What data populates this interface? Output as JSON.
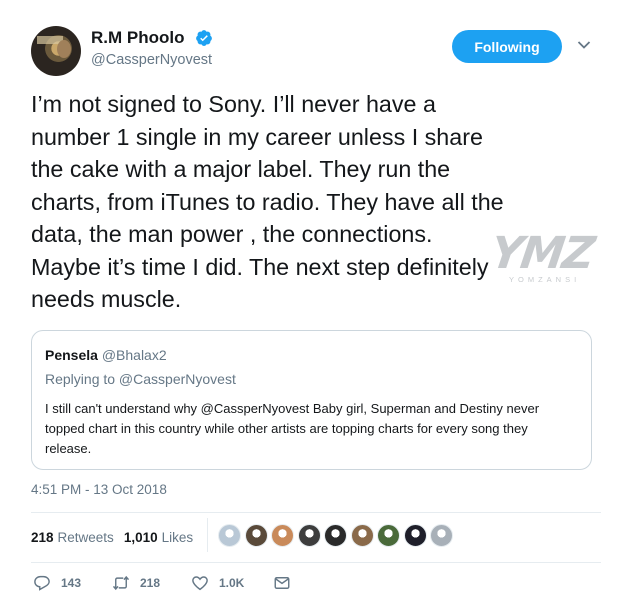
{
  "author": {
    "display_name": "R.M Phoolo",
    "handle": "@CassperNyovest",
    "verified": true,
    "follow_button_label": "Following"
  },
  "tweet": {
    "lines": [
      "I’m not signed to Sony. I’ll never have a",
      "number 1 single in my career unless I share",
      "the cake with a major label. They run the",
      "charts, from iTunes to radio. They have all the",
      "data, the man power , the connections.",
      "Maybe it’s time I did. The next step definitely",
      "needs muscle."
    ]
  },
  "watermark": {
    "logo_text": "YMZ",
    "sub_text": "YOMZANSI"
  },
  "quoted_tweet": {
    "name": "Pensela",
    "handle": "@Bhalax2",
    "replying_to": "Replying to @CassperNyovest",
    "lines": [
      "I still can't understand why @CassperNyovest Baby girl, Superman and Destiny never",
      "topped chart in this country while other artists are topping charts for every song they",
      "release."
    ]
  },
  "timestamp": "4:51 PM - 13 Oct 2018",
  "stats": {
    "retweets_count": "218",
    "retweets_label": "Retweets",
    "likes_count": "1,010",
    "likes_label": "Likes"
  },
  "liker_avatars": [
    {
      "icon": "liker-avatar",
      "color": "#b9c8d6"
    },
    {
      "icon": "liker-avatar",
      "color": "#5a4a3a"
    },
    {
      "icon": "liker-avatar",
      "color": "#c98a5a"
    },
    {
      "icon": "liker-avatar",
      "color": "#3d3d3d"
    },
    {
      "icon": "liker-avatar",
      "color": "#2a2a2a"
    },
    {
      "icon": "liker-avatar",
      "color": "#8a6a4a"
    },
    {
      "icon": "liker-avatar",
      "color": "#4a6a3a"
    },
    {
      "icon": "liker-avatar",
      "color": "#1f1f2a"
    },
    {
      "icon": "liker-avatar",
      "color": "#a8b0b8"
    }
  ],
  "actions": {
    "reply_count": "143",
    "retweet_count": "218",
    "like_count": "1.0K"
  },
  "colors": {
    "accent": "#1da1f2",
    "text_primary": "#14171a",
    "text_secondary": "#657786",
    "border": "#e6ecf0"
  }
}
